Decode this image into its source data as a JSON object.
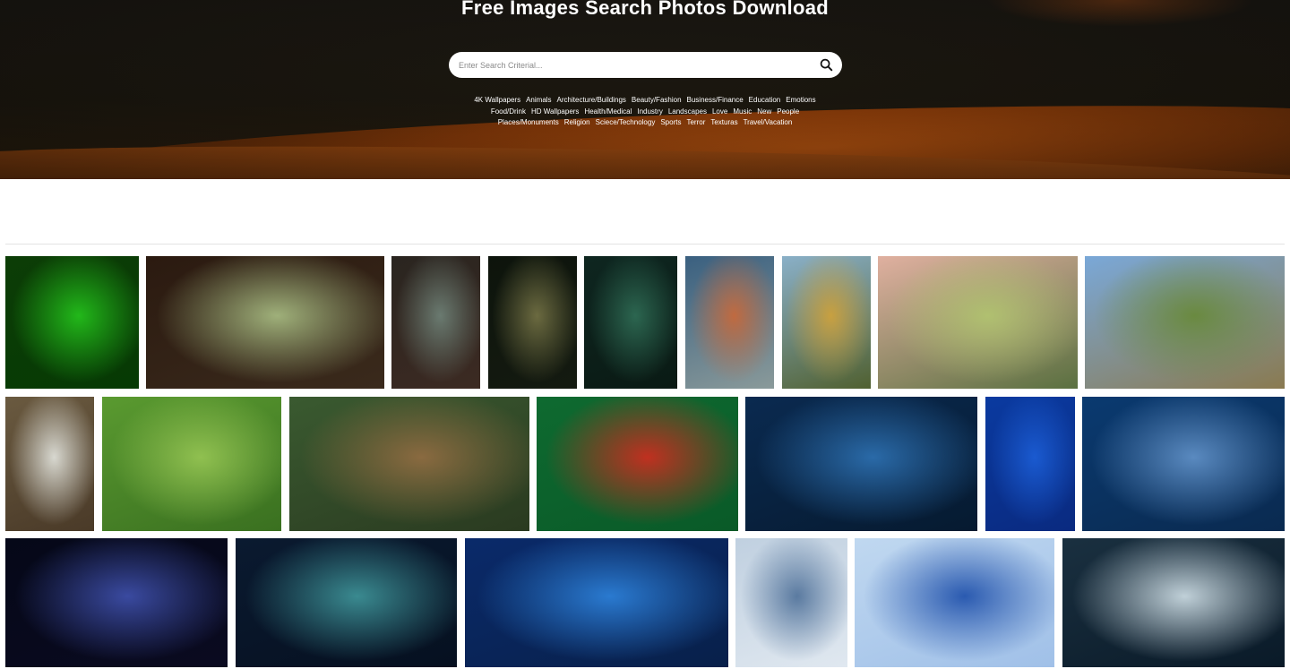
{
  "header": {
    "title": "Free Images Search Photos Download"
  },
  "search": {
    "placeholder": "Enter Search Criterial...",
    "icon": "search-icon"
  },
  "categories": [
    "4K Wallpapers",
    "Animals",
    "Architecture/Buildings",
    "Beauty/Fashion",
    "Business/Finance",
    "Education",
    "Emotions",
    "Food/Drink",
    "HD Wallpapers",
    "Health/Medical",
    "Industry",
    "Landscapes",
    "Love",
    "Music",
    "New",
    "People",
    "Places/Monuments",
    "Religion",
    "Sciece/Technology",
    "Sports",
    "Terror",
    "Texturas",
    "Travel/Vacation"
  ],
  "gallery": [
    {
      "name": "green-neon-portrait",
      "colors": [
        "#0c3d06",
        "#22b81a",
        "#063a04"
      ]
    },
    {
      "name": "japanese-bedroom-window",
      "colors": [
        "#2b1a10",
        "#9fb07a",
        "#3a2a1c"
      ]
    },
    {
      "name": "wooden-surfboards",
      "colors": [
        "#2a2520",
        "#6a7a70",
        "#3c2a22"
      ]
    },
    {
      "name": "dark-jungle-light",
      "colors": [
        "#0d140c",
        "#6b6a40",
        "#141a10"
      ]
    },
    {
      "name": "tropical-leaves",
      "colors": [
        "#0e2620",
        "#2c6650",
        "#0a1a14"
      ]
    },
    {
      "name": "beach-huts",
      "colors": [
        "#3a6080",
        "#c06a40",
        "#8a9a9a"
      ]
    },
    {
      "name": "camper-roof-tent",
      "colors": [
        "#8ab0c8",
        "#c8a040",
        "#506030"
      ]
    },
    {
      "name": "woman-arms-raised-field",
      "colors": [
        "#e0b0a0",
        "#b0c070",
        "#5a7040"
      ]
    },
    {
      "name": "cabin-hill-landscape",
      "colors": [
        "#7aa8d8",
        "#6a8a40",
        "#8a7a50"
      ]
    },
    {
      "name": "white-dog-hillside",
      "colors": [
        "#6a5a40",
        "#d8d8d0",
        "#4a3a28"
      ]
    },
    {
      "name": "man-lying-meadow",
      "colors": [
        "#5a9a30",
        "#90c050",
        "#3a7020"
      ]
    },
    {
      "name": "monkey-resting-log",
      "colors": [
        "#3a5a30",
        "#8a6a40",
        "#2a3a20"
      ]
    },
    {
      "name": "dog-christmas-elf-hat",
      "colors": [
        "#0e6a30",
        "#c03020",
        "#0a5a28"
      ]
    },
    {
      "name": "city-skyline-night",
      "colors": [
        "#0a2a50",
        "#2a6aa8",
        "#061a30"
      ]
    },
    {
      "name": "blue-wood-planks",
      "colors": [
        "#0a3aa0",
        "#1a5ad0",
        "#0a2a80"
      ]
    },
    {
      "name": "water-ripples-blue",
      "colors": [
        "#0a3a70",
        "#5a8ac0",
        "#0a2a50"
      ]
    },
    {
      "name": "lightning-night-sky",
      "colors": [
        "#050818",
        "#3a4aa0",
        "#0a0a20"
      ]
    },
    {
      "name": "aurora-cave",
      "colors": [
        "#0a1a30",
        "#3a8a90",
        "#061020"
      ]
    },
    {
      "name": "blue-forest-road",
      "colors": [
        "#0a2a6a",
        "#2a7ad0",
        "#08204a"
      ]
    },
    {
      "name": "glass-building-sky",
      "colors": [
        "#c0d0e0",
        "#5a7aa0",
        "#e0e8f0"
      ]
    },
    {
      "name": "soap-bubble-cells",
      "colors": [
        "#c0d8f0",
        "#2a5ab0",
        "#a0c0e8"
      ]
    },
    {
      "name": "light-streaks-tunnel",
      "colors": [
        "#1a3040",
        "#c0d0d8",
        "#0a1a28"
      ]
    }
  ]
}
